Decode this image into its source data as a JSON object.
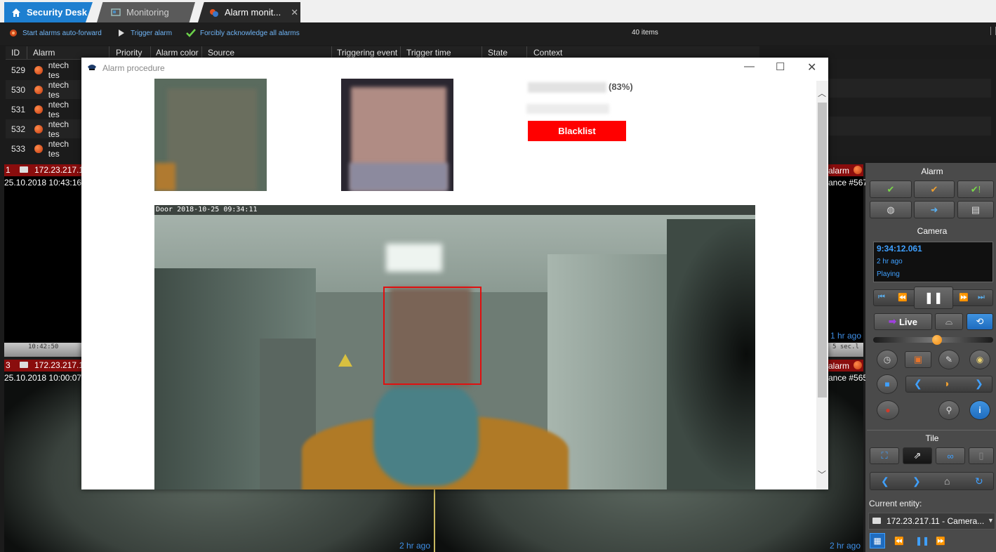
{
  "tabs": [
    {
      "label": "Security Desk",
      "icon": "home-icon"
    },
    {
      "label": "Monitoring",
      "icon": "monitoring-icon"
    },
    {
      "label": "Alarm monit...",
      "icon": "alarm-monitoring-icon",
      "close": "✕"
    }
  ],
  "toolbar": {
    "auto_forward_label": "Start alarms auto-forward",
    "trigger_label": "Trigger alarm",
    "acknowledge_label": "Forcibly acknowledge all alarms",
    "items_count": "40 items"
  },
  "table": {
    "columns": [
      "ID",
      "Alarm",
      "Priority",
      "Alarm color",
      "Source",
      "Triggering event",
      "Trigger time",
      "State",
      "Context"
    ],
    "rows": [
      {
        "id": "529",
        "alarm": "ntech tes"
      },
      {
        "id": "530",
        "alarm": "ntech tes"
      },
      {
        "id": "531",
        "alarm": "ntech tes"
      },
      {
        "id": "532",
        "alarm": "ntech tes"
      },
      {
        "id": "533",
        "alarm": "ntech tes"
      }
    ]
  },
  "tiles": [
    {
      "num": "1",
      "ip": "172.23.217.1",
      "time": "25.10.2018 10:43:16",
      "right_label": "alarm",
      "right_sub": "ance #567",
      "ago": "1 hr ago",
      "timeline_left": "10:42:50",
      "timeline_right": "5 sec.l"
    },
    {
      "num": "3",
      "ip": "172.23.217.1",
      "time": "25.10.2018 10:00:07",
      "right_label": "alarm",
      "right_sub": "ance #565",
      "ago_left": "2 hr ago",
      "ago_right": "2 hr ago"
    }
  ],
  "panel": {
    "alarm_title": "Alarm",
    "camera_title": "Camera",
    "time": "9:34:12.061",
    "ago": "2 hr ago",
    "status": "Playing",
    "live_label": "Live",
    "tile_title": "Tile",
    "current_entity_label": "Current entity:",
    "current_entity_value": "172.23.217.11 - Camera...",
    "slider_fraction": 0.53
  },
  "modal": {
    "title": "Alarm procedure",
    "match_percent": "(83%)",
    "blacklist_label": "Blacklist",
    "video_osd": "Door 2018-10-25 09:34:11"
  },
  "colors": {
    "accent": "#1e7fd0",
    "link": "#6fb4f5",
    "alarm_red": "#8a0d0d",
    "blacklist": "#ff0000"
  }
}
